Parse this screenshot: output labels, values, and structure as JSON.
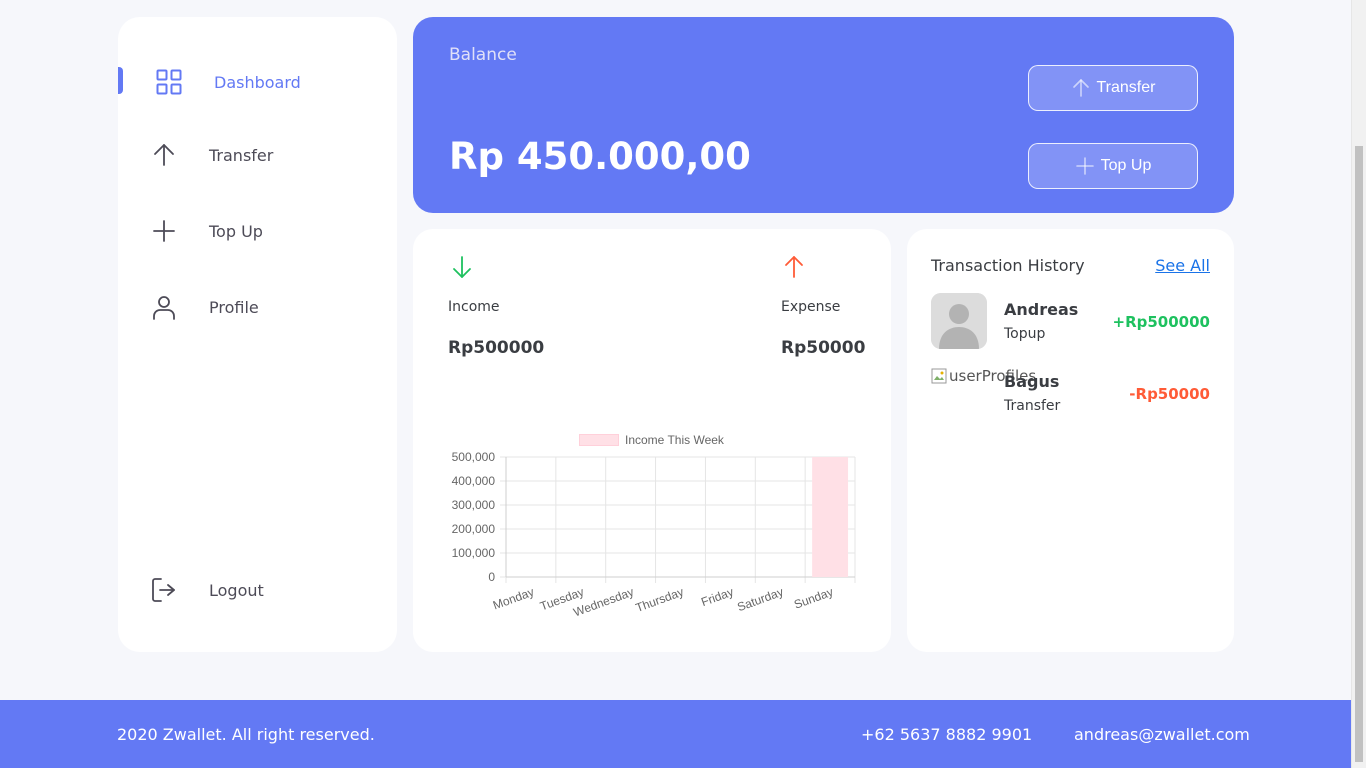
{
  "sidebar": {
    "items": [
      {
        "label": "Dashboard",
        "icon": "grid-icon"
      },
      {
        "label": "Transfer",
        "icon": "arrow-up-icon"
      },
      {
        "label": "Top Up",
        "icon": "plus-icon"
      },
      {
        "label": "Profile",
        "icon": "user-icon"
      }
    ],
    "logout": {
      "label": "Logout",
      "icon": "logout-icon"
    }
  },
  "balance": {
    "label": "Balance",
    "amount": "Rp 450.000,00",
    "transfer_label": "Transfer",
    "topup_label": "Top Up"
  },
  "stats": {
    "income_label": "Income",
    "income_value": "Rp500000",
    "expense_label": "Expense",
    "expense_value": "Rp50000",
    "income_color": "#1ec15f",
    "expense_color": "#ff5b37"
  },
  "chart_data": {
    "type": "bar",
    "categories": [
      "Monday",
      "Tuesday",
      "Wednesday",
      "Thursday",
      "Friday",
      "Saturday",
      "Sunday"
    ],
    "series": [
      {
        "name": "Income This Week",
        "values": [
          0,
          0,
          0,
          0,
          0,
          0,
          500000
        ]
      }
    ],
    "yticks": [
      "500,000",
      "400,000",
      "300,000",
      "200,000",
      "100,000",
      "0"
    ],
    "ylim": [
      0,
      500000
    ],
    "grid": true,
    "legend": "top",
    "bar_color": "#ffe0e6"
  },
  "transactions": {
    "title": "Transaction History",
    "see_all": "See All",
    "items": [
      {
        "name": "Andreas",
        "type": "Topup",
        "amount": "+Rp500000",
        "color": "#1ec15f"
      },
      {
        "name": "Bagus",
        "type": "Transfer",
        "amount": "-Rp50000",
        "color": "#ff5b37",
        "avatar_alt": "userProfiles"
      }
    ]
  },
  "footer": {
    "copyright": "2020 Zwallet. All right reserved.",
    "phone": "+62 5637 8882 9901",
    "email": "andreas@zwallet.com"
  },
  "colors": {
    "primary": "#6379f4",
    "background": "#f6f7fb"
  }
}
